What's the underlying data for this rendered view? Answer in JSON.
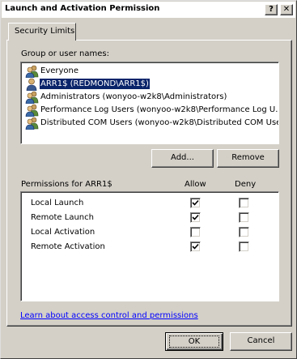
{
  "window": {
    "title": "Launch and Activation Permission",
    "help_button": "?",
    "close_button": "✕"
  },
  "tabs": [
    {
      "label": "Security Limits",
      "active": true
    }
  ],
  "users_section": {
    "label": "Group or user names:",
    "users": [
      {
        "name": "Everyone",
        "icon": "group-icon",
        "selected": false
      },
      {
        "name": "ARR1$ (REDMOND\\ARR1$)",
        "icon": "user-icon",
        "selected": true
      },
      {
        "name": "Administrators (wonyoo-w2k8\\Administrators)",
        "icon": "group-icon",
        "selected": false
      },
      {
        "name": "Performance Log Users (wonyoo-w2k8\\Performance Log U...",
        "icon": "group-icon",
        "selected": false
      },
      {
        "name": "Distributed COM Users (wonyoo-w2k8\\Distributed COM Use...",
        "icon": "group-icon",
        "selected": false
      }
    ],
    "add_button": "Add...",
    "remove_button": "Remove"
  },
  "permissions_section": {
    "label": "Permissions for ARR1$",
    "allow_header": "Allow",
    "deny_header": "Deny",
    "permissions": [
      {
        "name": "Local Launch",
        "allow": true,
        "deny": false
      },
      {
        "name": "Remote Launch",
        "allow": true,
        "deny": false
      },
      {
        "name": "Local Activation",
        "allow": false,
        "deny": false
      },
      {
        "name": "Remote Activation",
        "allow": true,
        "deny": false
      }
    ]
  },
  "learn_link": "Learn about access control and permissions",
  "footer": {
    "ok_button": "OK",
    "cancel_button": "Cancel"
  },
  "colors": {
    "dialog_face": "#d4d0c8",
    "selection": "#0a246a",
    "link": "#0000ff"
  }
}
